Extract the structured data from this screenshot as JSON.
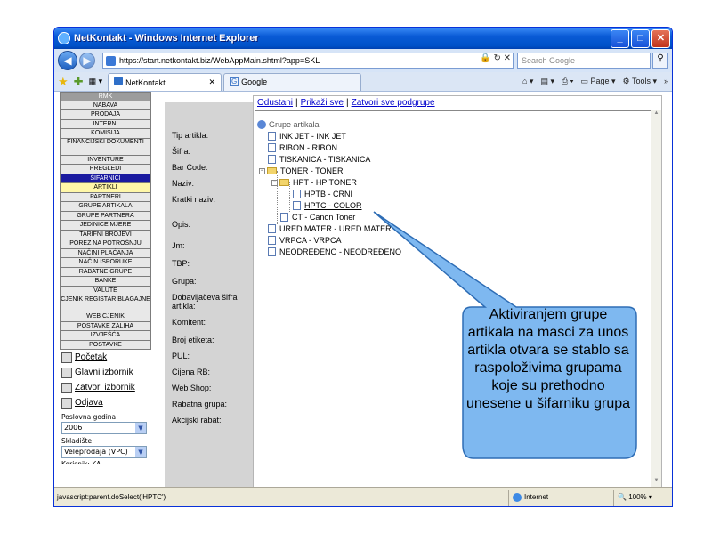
{
  "window": {
    "title": "NetKontakt - Windows Internet Explorer",
    "buttons": {
      "minimize": "_",
      "maximize": "□",
      "close": "✕"
    }
  },
  "address": {
    "url": "https://start.netkontakt.biz/WebAppMain.shtml?app=SKL",
    "search_placeholder": "Search Google"
  },
  "tabs": [
    {
      "label": "NetKontakt",
      "close": "✕"
    },
    {
      "label": "Google"
    }
  ],
  "toolbar": {
    "page_label": "Page",
    "tools_label": "Tools",
    "overflow": "»"
  },
  "sidebar": {
    "header": "RMK",
    "items": [
      "NABAVA",
      "PRODAJA",
      "INTERNI",
      "KOMISIJA",
      "FINANCIJSKI DOKUMENTI",
      "INVENTURE",
      "PREGLEDI",
      "ŠIFARNICI",
      "ARTIKLI",
      "PARTNERI",
      "GRUPE ARTIKALA",
      "GRUPE PARTNERA",
      "JEDINICE MJERE",
      "TARIFNI BROJEVI",
      "POREZ NA POTROŠNJU",
      "NAČINI PLAĆANJA",
      "NAČIN ISPORUKE",
      "RABATNE GRUPE",
      "BANKE",
      "VALUTE",
      "CJENIK REGISTAR BLAGAJNE",
      "WEB CJENIK",
      "POSTAVKE ZALIHA",
      "IZVJEŠĆA",
      "POSTAVKE"
    ],
    "links": [
      "Početak",
      "Glavni izbornik",
      "Zatvori izbornik",
      "Odjava"
    ],
    "year_label": "Poslovna godina",
    "year_value": "2006",
    "warehouse_label": "Skladište",
    "warehouse_value": "Veleprodaja (VPC)",
    "cut_label": "Korisnik: KA"
  },
  "form": {
    "labels": [
      "Tip artikla:",
      "Šifra:",
      "Bar Code:",
      "Naziv:",
      "Kratki naziv:",
      "Opis:",
      "Jm:",
      "TBP:",
      "Grupa:",
      "Dobavljačeva šifra artikla:",
      "Komitent:",
      "Broj etiketa:",
      "PUL:",
      "Cijena RB:",
      "Web Shop:",
      "Rabatna grupa:",
      "Akcijski rabat:"
    ]
  },
  "popup": {
    "link_cancel": "Odustani",
    "link_show_all": "Prikaži sve",
    "link_close_all": "Zatvori sve podgrupe",
    "separator": "|",
    "tree_root": "Grupe artikala",
    "nodes": [
      "INK JET - INK JET",
      "RIBON - RIBON",
      "TISKANICA - TISKANICA",
      "TONER - TONER",
      "HPT - HP TONER",
      "HPTB - CRNI",
      "HPTC - COLOR",
      "CT - Canon Toner",
      "URED MATER - URED MATER",
      "VRPCA - VRPCA",
      "NEODREĐENO - NEODREĐENO"
    ],
    "expand_minus": "−"
  },
  "statusbar": {
    "text": "javascript:parent.doSelect('HPTC')",
    "zone": "Internet",
    "zoom": "100%"
  },
  "callout": {
    "text": "Aktiviranjem grupe artikala na masci za unos artikla otvara se stablo sa raspoloživima grupama koje su prethodno unesene u šifarniku grupa",
    "fill_color": "#7eb8f0",
    "border_color": "#2e6db5"
  }
}
